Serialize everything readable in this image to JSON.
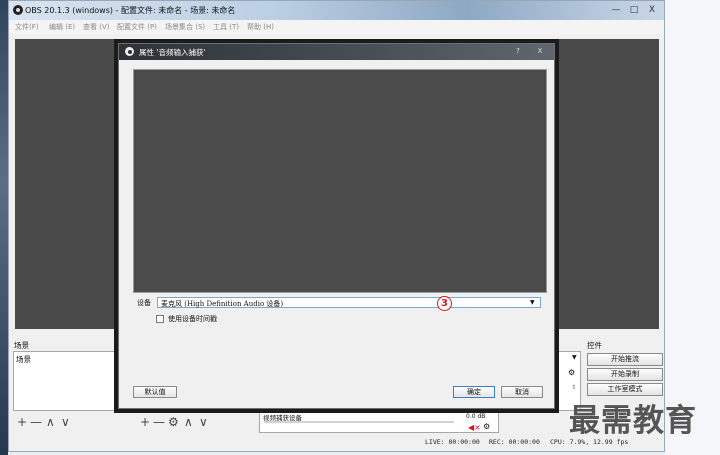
{
  "window": {
    "title": "OBS 20.1.3 (windows) - 配置文件: 未命名 - 场景: 未命名",
    "controls": {
      "minimize": "—",
      "maximize": "□",
      "close": "X"
    }
  },
  "menubar": {
    "items": [
      "文件(F)",
      "编辑 (E)",
      "查看 (V)",
      "配置文件 (P)",
      "场景集合 (S)",
      "工具 (T)",
      "帮助 (H)"
    ]
  },
  "docks": {
    "scenes": {
      "title": "场景",
      "items": [
        "场景"
      ],
      "toolbar": {
        "add": "+",
        "remove": "—",
        "up": "∧",
        "down": "∨"
      }
    },
    "sources": {
      "toolbar": {
        "add": "+",
        "remove": "—",
        "settings": "⚙",
        "up": "∧",
        "down": "∨"
      }
    },
    "mixer": {
      "source_name": "视频捕获设备",
      "level": "0.0 dB"
    },
    "controls": {
      "title": "控件",
      "buttons": [
        "开始推流",
        "开始录制",
        "工作室模式"
      ]
    }
  },
  "status": {
    "live": "LIVE: 00:00:00",
    "rec": "REC: 00:00:00",
    "cpu": "CPU: 7.9%, 12.99 fps"
  },
  "dialog": {
    "title": "属性 '音频输入捕获'",
    "help": "?",
    "close": "X",
    "device_label": "设备",
    "device_value": "麦克风 (High Definition Audio 设备)",
    "timestamp_label": "使用设备时间戳",
    "defaults_button": "默认值",
    "ok_button": "确定",
    "cancel_button": "取消"
  },
  "annotation": {
    "marker": "3"
  },
  "watermark": {
    "text": "最需教育"
  },
  "colors": {
    "accent_ring": "#d21a1a",
    "preview_bg": "#4a4a4a",
    "dialog_title_bg": "#2e3238"
  }
}
